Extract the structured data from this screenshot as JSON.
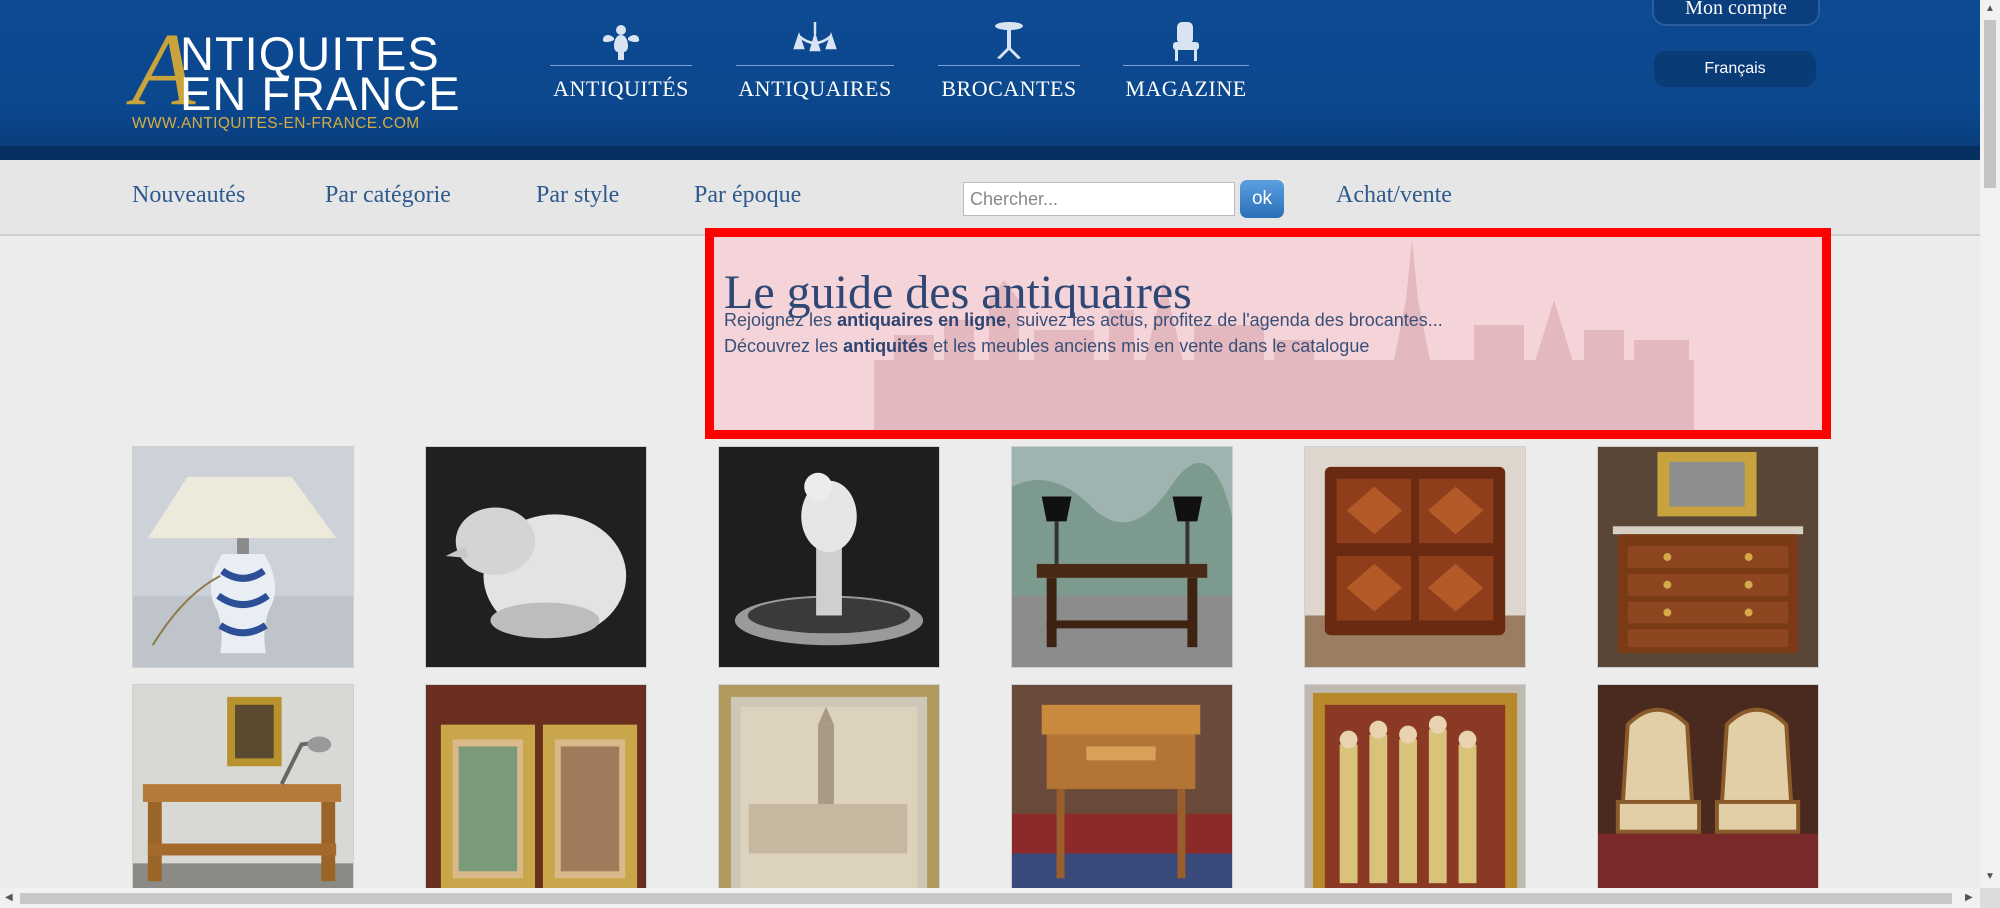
{
  "header": {
    "logo": {
      "letter": "A",
      "line1": "NTIQUITES",
      "line2": "EN FRANCE",
      "url": "WWW.ANTIQUITES-EN-FRANCE.COM"
    },
    "nav": [
      {
        "label": "ANTIQUITÉS",
        "icon": "cherub-icon"
      },
      {
        "label": "ANTIQUAIRES",
        "icon": "chandelier-icon"
      },
      {
        "label": "BROCANTES",
        "icon": "pedestal-table-icon"
      },
      {
        "label": "MAGAZINE",
        "icon": "armchair-icon"
      }
    ],
    "account_label": "Mon compte",
    "language": "Français"
  },
  "subnav": {
    "links": [
      "Nouveautés",
      "Par catégorie",
      "Par style",
      "Par époque"
    ],
    "search_placeholder": "Chercher...",
    "search_button": "ok",
    "achat_vente": "Achat/vente"
  },
  "hero": {
    "title": "Le guide des antiquaires",
    "line1_pre": "Rejoignez les ",
    "line1_bold": "antiquaires en ligne",
    "line1_post": ", suivez les actus, profitez de l'agenda des brocantes...",
    "line2_pre": "Découvrez les ",
    "line2_bold": "antiquités",
    "line2_post": " et les meubles anciens mis en vente dans le catalogue"
  },
  "products": [
    {
      "name": "blue-white-porcelain-lamp"
    },
    {
      "name": "frosted-glass-bird"
    },
    {
      "name": "crystal-dove-ring-dish"
    },
    {
      "name": "oak-refectory-table-with-lamps"
    },
    {
      "name": "marquetry-cabinet"
    },
    {
      "name": "louis-xv-commode-with-mirror"
    },
    {
      "name": "workbench-console"
    },
    {
      "name": "pair-of-framed-paintings"
    },
    {
      "name": "framed-city-watercolor"
    },
    {
      "name": "marquetry-dressing-table"
    },
    {
      "name": "figurative-tapestry-painting"
    },
    {
      "name": "pair-of-louis-xv-armchairs"
    }
  ],
  "colors": {
    "header_blue": "#0b478d",
    "gold": "#c9a33b",
    "link_blue": "#2e5a8e",
    "hero_red": "#ff0000"
  }
}
